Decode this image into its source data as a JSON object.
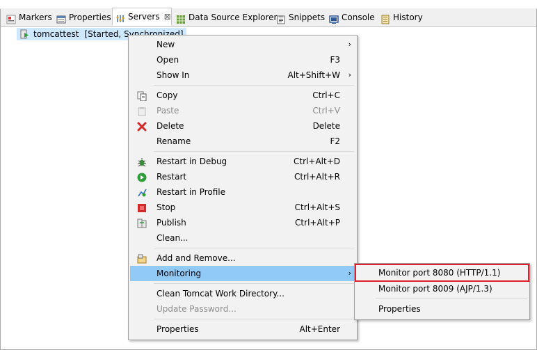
{
  "tabs": [
    {
      "label": "Markers",
      "icon": "markers-icon",
      "active": false
    },
    {
      "label": "Properties",
      "icon": "properties-icon",
      "active": false
    },
    {
      "label": "Servers",
      "icon": "servers-icon",
      "active": true
    },
    {
      "label": "Data Source Explorer",
      "icon": "data-source-icon",
      "active": false
    },
    {
      "label": "Snippets",
      "icon": "snippets-icon",
      "active": false
    },
    {
      "label": "Console",
      "icon": "console-icon",
      "active": false
    },
    {
      "label": "History",
      "icon": "history-icon",
      "active": false
    }
  ],
  "close_glyph": "⊠",
  "server": {
    "name": "tomcattest",
    "status": "[Started, Synchronized]"
  },
  "menu": {
    "items": [
      {
        "label": "New",
        "shortcut": "",
        "submenu": true
      },
      {
        "label": "Open",
        "shortcut": "F3"
      },
      {
        "label": "Show In",
        "shortcut": "Alt+Shift+W",
        "submenu": true
      },
      {
        "label": "Copy",
        "shortcut": "Ctrl+C",
        "icon": "copy-icon"
      },
      {
        "label": "Paste",
        "shortcut": "Ctrl+V",
        "icon": "paste-icon",
        "disabled": true
      },
      {
        "label": "Delete",
        "shortcut": "Delete",
        "icon": "delete-icon"
      },
      {
        "label": "Rename",
        "shortcut": "F2"
      },
      {
        "label": "Restart in Debug",
        "shortcut": "Ctrl+Alt+D",
        "icon": "debug-icon"
      },
      {
        "label": "Restart",
        "shortcut": "Ctrl+Alt+R",
        "icon": "restart-icon"
      },
      {
        "label": "Restart in Profile",
        "shortcut": "",
        "icon": "profile-icon"
      },
      {
        "label": "Stop",
        "shortcut": "Ctrl+Alt+S",
        "icon": "stop-icon"
      },
      {
        "label": "Publish",
        "shortcut": "Ctrl+Alt+P",
        "icon": "publish-icon"
      },
      {
        "label": "Clean...",
        "shortcut": ""
      },
      {
        "label": "Add and Remove...",
        "shortcut": "",
        "icon": "add-remove-icon"
      },
      {
        "label": "Monitoring",
        "shortcut": "",
        "submenu": true,
        "highlighted": true
      },
      {
        "label": "Clean Tomcat Work Directory...",
        "shortcut": ""
      },
      {
        "label": "Update Password...",
        "shortcut": "",
        "disabled": true
      },
      {
        "label": "Properties",
        "shortcut": "Alt+Enter"
      }
    ],
    "submenu_arrow": "›"
  },
  "submenu": {
    "items": [
      {
        "label": "Monitor port 8080 (HTTP/1.1)",
        "boxed": true
      },
      {
        "label": "Monitor port 8009 (AJP/1.3)"
      },
      {
        "label": "Properties"
      }
    ]
  },
  "colors": {
    "highlight": "#91c9f7",
    "selection": "#cde8ff",
    "callout": "#e0202a"
  }
}
